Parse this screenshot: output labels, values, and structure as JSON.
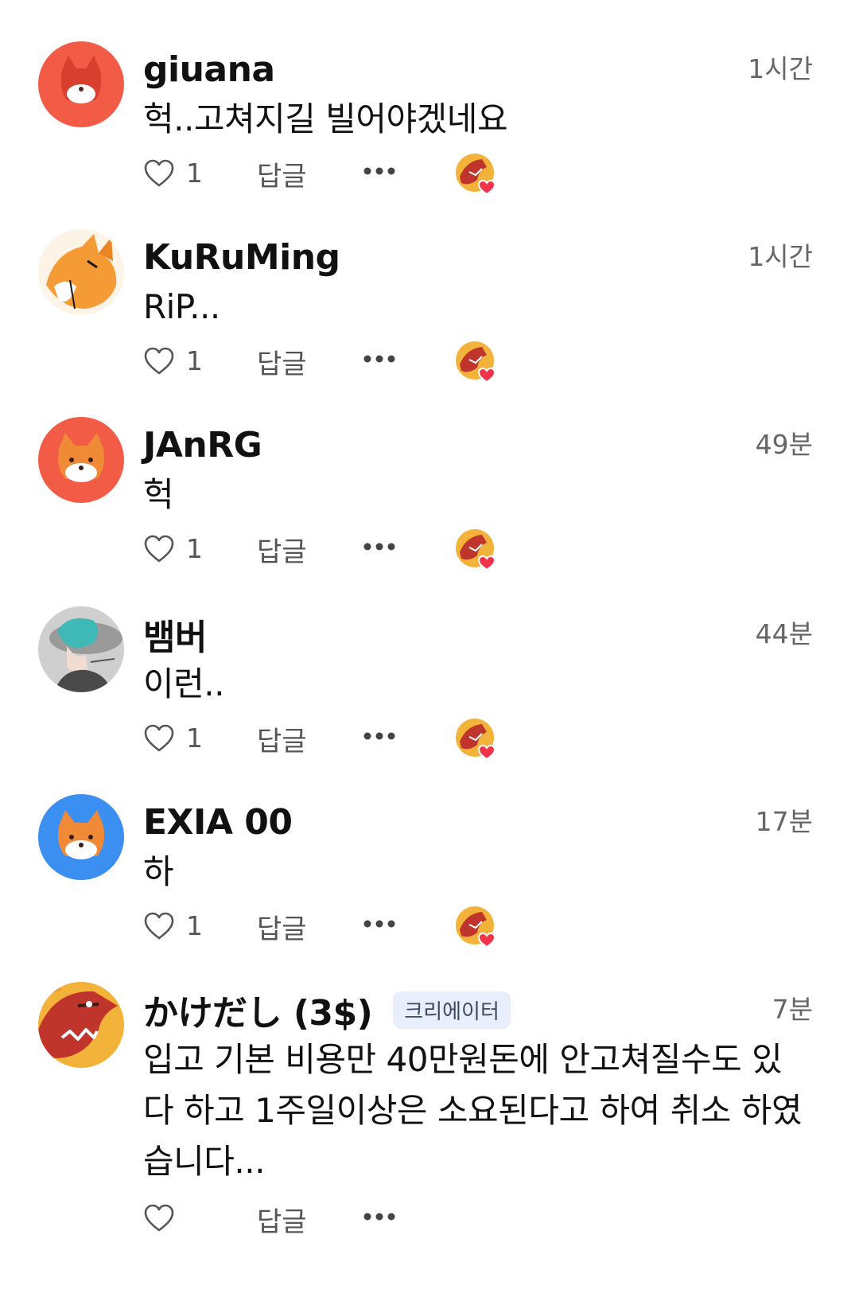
{
  "comments": [
    {
      "author": "giuana",
      "time": "1시간",
      "text": "헉..고쳐지길 빌어야겠네요",
      "likes": "1",
      "avatar": "fox-avatar",
      "avatar_bg": "#f25c47"
    },
    {
      "author": "KuRuMing",
      "time": "1시간",
      "text": "RiP...",
      "likes": "1",
      "avatar": "drawn-fox-avatar",
      "avatar_bg": "#fdf3e6"
    },
    {
      "author": "JAnRG",
      "time": "49분",
      "text": "헉",
      "likes": "1",
      "avatar": "fox-avatar",
      "avatar_bg": "#f25c47"
    },
    {
      "author": "뱀버",
      "time": "44분",
      "text": "이런..",
      "likes": "1",
      "avatar": "anime-character-avatar",
      "avatar_bg": "#cfcfcf"
    },
    {
      "author": "EXIA 00",
      "time": "17분",
      "text": "하",
      "likes": "1",
      "avatar": "fox-avatar",
      "avatar_bg": "#3b8ff0"
    },
    {
      "author": "かけだし (3$)",
      "badge": "크리에이터",
      "time": "7분",
      "text": "입고 기본 비용만 40만원돈에 안고쳐질수도 있다 하고 1주일이상은 소요된다고 하여 취소 하였습니다...",
      "likes": "",
      "avatar": "dragon-creature-avatar",
      "avatar_bg": "#f3b23a"
    }
  ],
  "labels": {
    "reply": "답글"
  },
  "colors": {
    "heart_red": "#f2334a",
    "muted_text": "#666666",
    "badge_bg": "#e8eefb"
  }
}
